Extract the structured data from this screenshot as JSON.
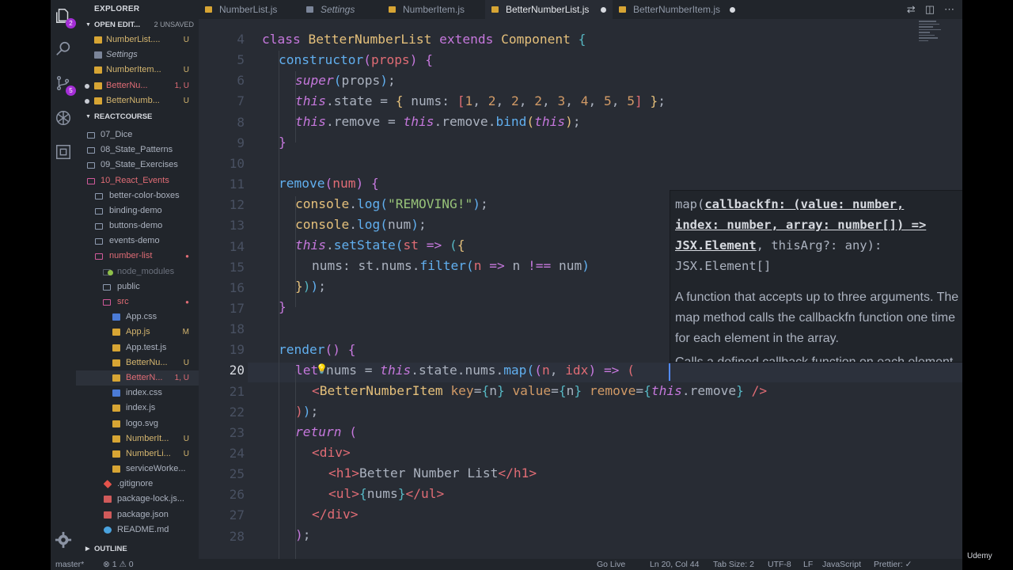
{
  "activity": {
    "explorer_badge": "2",
    "scm_badge": "5"
  },
  "sidebar": {
    "title": "EXPLORER",
    "open_editors": {
      "label": "OPEN EDIT...",
      "unsaved": "2 UNSAVED"
    },
    "open_files": [
      {
        "name": "NumberList....",
        "status": "U"
      },
      {
        "name": "Settings",
        "status": ""
      },
      {
        "name": "NumberItem...",
        "status": "U"
      },
      {
        "name": "BetterNu...",
        "status": "1, U"
      },
      {
        "name": "BetterNumb...",
        "status": "U"
      }
    ],
    "project": "REACTCOURSE",
    "tree": [
      {
        "name": "07_Dice",
        "status": ""
      },
      {
        "name": "08_State_Patterns",
        "status": ""
      },
      {
        "name": "09_State_Exercises",
        "status": ""
      },
      {
        "name": "10_React_Events",
        "status": ""
      },
      {
        "name": "better-color-boxes",
        "status": ""
      },
      {
        "name": "binding-demo",
        "status": ""
      },
      {
        "name": "buttons-demo",
        "status": ""
      },
      {
        "name": "events-demo",
        "status": ""
      },
      {
        "name": "number-list",
        "status": ""
      },
      {
        "name": "node_modules",
        "status": ""
      },
      {
        "name": "public",
        "status": ""
      },
      {
        "name": "src",
        "status": ""
      },
      {
        "name": "App.css",
        "status": ""
      },
      {
        "name": "App.js",
        "status": "M"
      },
      {
        "name": "App.test.js",
        "status": ""
      },
      {
        "name": "BetterNu...",
        "status": "U"
      },
      {
        "name": "BetterN...",
        "status": "1, U"
      },
      {
        "name": "index.css",
        "status": ""
      },
      {
        "name": "index.js",
        "status": ""
      },
      {
        "name": "logo.svg",
        "status": ""
      },
      {
        "name": "NumberIt...",
        "status": "U"
      },
      {
        "name": "NumberLi...",
        "status": "U"
      },
      {
        "name": "serviceWorke...",
        "status": ""
      },
      {
        "name": ".gitignore",
        "status": ""
      },
      {
        "name": "package-lock.js...",
        "status": ""
      },
      {
        "name": "package.json",
        "status": ""
      },
      {
        "name": "README.md",
        "status": ""
      }
    ],
    "outline": "OUTLINE"
  },
  "tabs": [
    "NumberList.js",
    "Settings",
    "NumberItem.js",
    "BetterNumberList.js",
    "BetterNumberItem.js"
  ],
  "editor": {
    "line_numbers": [
      "4",
      "5",
      "6",
      "7",
      "8",
      "9",
      "10",
      "11",
      "12",
      "13",
      "14",
      "15",
      "16",
      "17",
      "18",
      "19",
      "20",
      "21",
      "22",
      "23",
      "24",
      "25",
      "26",
      "27",
      "28"
    ]
  },
  "hover": {
    "sig_1": "map(",
    "sig_2": "callbackfn: (value: number,",
    "sig_3": "index: number, array: number[]) =>",
    "sig_4": "JSX.Element",
    "sig_5": ", thisArg?: any):",
    "sig_6": "JSX.Element[]",
    "doc": "A function that accepts up to three arguments. The map method calls the callbackfn function one time for each element in the array.",
    "doc_cut": "Calls a defined callback function on each element"
  },
  "status": {
    "branch": "master*",
    "problems": "⊗ 1 ⚠ 0",
    "go_live": "Go Live",
    "position": "Ln 20, Col 44",
    "tab_size": "Tab Size: 2",
    "encoding": "UTF-8",
    "eol": "LF",
    "language": "JavaScript",
    "formatter": "Prettier: ✓"
  },
  "watermark": "Udemy"
}
